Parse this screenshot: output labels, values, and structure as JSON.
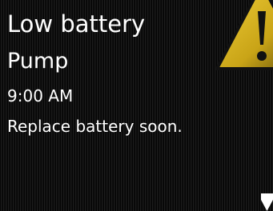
{
  "alert": {
    "title": "Low battery",
    "source": "Pump",
    "time": "9:00 AM",
    "message": "Replace battery soon."
  },
  "icons": {
    "warning": "warning-triangle-icon",
    "scroll": "down-arrow-icon"
  },
  "colors": {
    "text": "#ffffff",
    "warning_fill": "#e9c21c",
    "warning_outline": "#000000",
    "background": "#0a0a0a"
  }
}
